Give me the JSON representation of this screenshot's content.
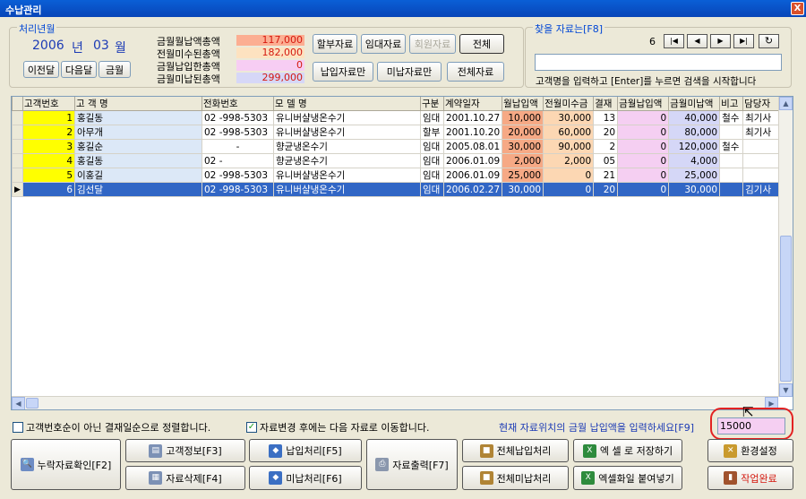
{
  "window": {
    "title": "수납관리",
    "close": "X"
  },
  "period": {
    "group_title": "처리년월",
    "year": "2006",
    "year_unit": "년",
    "month": "03",
    "month_unit": "월",
    "prev_btn": "이전달",
    "next_btn": "다음달",
    "this_btn": "금월"
  },
  "summary": [
    {
      "label": "금월월납액총액",
      "value": "117,000",
      "color": "#fcae92"
    },
    {
      "label": "전월미수된총액",
      "value": "182,000",
      "color": "#fde2c0"
    },
    {
      "label": "금월납입한총액",
      "value": "0",
      "color": "#f7cdf3"
    },
    {
      "label": "금월미납된총액",
      "value": "299,000",
      "color": "#d6d7f7"
    }
  ],
  "filters": {
    "installment": "할부자료",
    "rental": "임대자료",
    "member": "회원자료",
    "all": "전체",
    "paid_only": "납입자료만",
    "unpaid_only": "미납자료만",
    "all_data": "전체자료"
  },
  "search": {
    "group_title": "찾을 자료는[F8]",
    "record_no": "6",
    "nav_first": "|◀",
    "nav_prev": "◀",
    "nav_next": "▶",
    "nav_last": "▶|",
    "nav_refresh": "↻",
    "input_value": "",
    "hint": "고객명을 입력하고 [Enter]를 누르면 검색을 시작합니다"
  },
  "table": {
    "columns": [
      "고객번호",
      "고 객 명",
      "전화번호",
      "모  델  명",
      "구분",
      "계약일자",
      "월납입액",
      "전월미수금",
      "결재",
      "금월납입액",
      "금월미납액",
      "비고",
      "담당자"
    ],
    "rows": [
      {
        "ind": "",
        "no": "1",
        "name": "홍길동",
        "phone": "02  -998-5303",
        "model": "유니버샬냉온수기",
        "type": "임대",
        "date": "2001.10.27",
        "monthly": "10,000",
        "prev_unpaid": "30,000",
        "pay": "13",
        "paid": "0",
        "unpaid": "40,000",
        "note": "철수",
        "staff": "최기사"
      },
      {
        "ind": "",
        "no": "2",
        "name": "아무개",
        "phone": "02  -998-5303",
        "model": "유니버샬냉온수기",
        "type": "할부",
        "date": "2001.10.20",
        "monthly": "20,000",
        "prev_unpaid": "60,000",
        "pay": "20",
        "paid": "0",
        "unpaid": "80,000",
        "note": "",
        "staff": "최기사"
      },
      {
        "ind": "",
        "no": "3",
        "name": "홍길순",
        "phone": "-",
        "model": "향균냉온수기",
        "type": "임대",
        "date": "2005.08.01",
        "monthly": "30,000",
        "prev_unpaid": "90,000",
        "pay": "2",
        "paid": "0",
        "unpaid": "120,000",
        "note": "철수",
        "staff": ""
      },
      {
        "ind": "",
        "no": "4",
        "name": "홍길동",
        "phone": "02  -",
        "model": "향균냉온수기",
        "type": "임대",
        "date": "2006.01.09",
        "monthly": "2,000",
        "prev_unpaid": "2,000",
        "pay": "05",
        "paid": "0",
        "unpaid": "4,000",
        "note": "",
        "staff": ""
      },
      {
        "ind": "",
        "no": "5",
        "name": "이홍길",
        "phone": "02  -998-5303",
        "model": "유니버샬냉온수기",
        "type": "임대",
        "date": "2006.01.09",
        "monthly": "25,000",
        "prev_unpaid": "0",
        "pay": "21",
        "paid": "0",
        "unpaid": "25,000",
        "note": "",
        "staff": ""
      },
      {
        "ind": "▶",
        "no": "6",
        "name": "김선달",
        "phone": "02  -998-5303",
        "model": "유니버샬냉온수기",
        "type": "임대",
        "date": "2006.02.27",
        "monthly": "30,000",
        "prev_unpaid": "0",
        "pay": "20",
        "paid": "0",
        "unpaid": "30,000",
        "note": "",
        "staff": "김기사"
      }
    ]
  },
  "options": {
    "sort_label": "고객번호순이 아닌 결재일순으로 정렬합니다.",
    "sort_checked": false,
    "next_label": "자료변경 후에는 다음 자료로 이동합니다.",
    "next_checked": true,
    "pay_prompt": "현재 자료위치의 금월 납입액을 입력하세요[F9]",
    "pay_value": "15000"
  },
  "actions": {
    "missing": "누락자료확인[F2]",
    "customer_info": "고객정보[F3]",
    "delete": "자료삭제[F4]",
    "pay": "납입처리[F5]",
    "unpay": "미납처리[F6]",
    "print": "자료출력[F7]",
    "pay_all": "전체납입처리",
    "unpay_all": "전체미납처리",
    "excel_save": "엑 셀 로 저장하기",
    "excel_paste": "엑셀화일 붙여넣기",
    "settings": "환경설정",
    "done": "작업완료"
  }
}
